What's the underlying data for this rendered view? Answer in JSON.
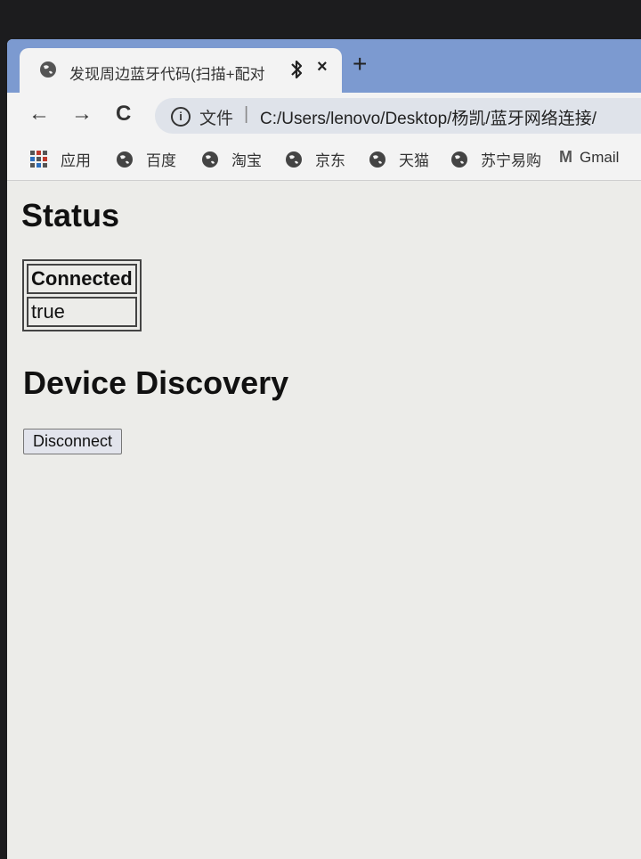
{
  "browser": {
    "tab": {
      "title": "发现周边蓝牙代码(扫描+配对",
      "close_glyph": "×",
      "icon": "globe-icon",
      "status_icon": "bluetooth-icon"
    },
    "new_tab_glyph": "+",
    "nav": {
      "back_glyph": "←",
      "forward_glyph": "→",
      "reload_glyph": "C"
    },
    "omnibox": {
      "info_glyph": "i",
      "scheme_label": "文件",
      "separator": "|",
      "url": "C:/Users/lenovo/Desktop/杨凯/蓝牙网络连接/"
    },
    "bookmarks": [
      {
        "label": "应用",
        "icon": "apps-grid-icon"
      },
      {
        "label": "百度",
        "icon": "globe-icon"
      },
      {
        "label": "淘宝",
        "icon": "globe-icon"
      },
      {
        "label": "京东",
        "icon": "globe-icon"
      },
      {
        "label": "天猫",
        "icon": "globe-icon"
      },
      {
        "label": "苏宁易购",
        "icon": "globe-icon"
      },
      {
        "label": "Gmail",
        "icon": "gmail-icon"
      }
    ],
    "gmail_glyph": "M"
  },
  "page": {
    "status_heading": "Status",
    "status_table": {
      "header": "Connected",
      "value": "true"
    },
    "discovery_heading": "Device Discovery",
    "disconnect_label": "Disconnect"
  },
  "colors": {
    "tabstrip": "#7c9ad0",
    "toolbar": "#f3f3f3",
    "page_background": "#ecece9"
  }
}
